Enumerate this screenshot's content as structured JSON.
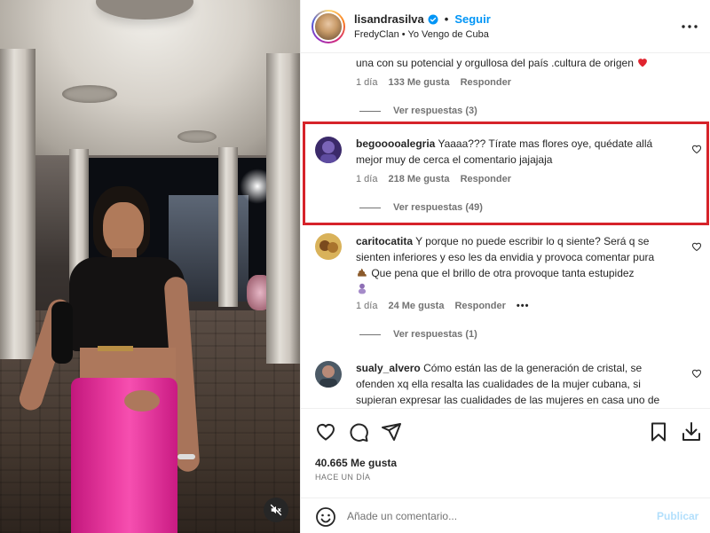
{
  "post": {
    "username": "lisandrasilva",
    "follow_label": "Seguir",
    "dot": "•",
    "subtitle": "FredyClan • Yo Vengo de Cuba",
    "more_label": "•••"
  },
  "comments": [
    {
      "text": "una con su potencial y orgullosa del país .cultura de origen",
      "emoji": "heart-emoji",
      "time": "1 día",
      "likes": "133 Me gusta",
      "reply": "Responder",
      "view_replies": "Ver respuestas (3)"
    },
    {
      "username": "begooooalegria",
      "text_line1": "Yaaaa??? Tírate mas flores oye, quédate allá",
      "text_line2": "mejor muy de cerca el comentario jajajaja",
      "time": "1 día",
      "likes": "218 Me gusta",
      "reply": "Responder",
      "view_replies": "Ver respuestas (49)",
      "highlighted": true
    },
    {
      "username": "caritocatita",
      "text_line1": "Y porque no puede escribir lo q siente? Será q se",
      "text_line2": "sienten inferiores y eso les da envidia y provoca comentar pura",
      "text_line3": "Que pena que el brillo de otra provoque tanta estupidez",
      "time": "1 día",
      "likes": "24 Me gusta",
      "reply": "Responder",
      "more": "•••",
      "view_replies": "Ver respuestas (1)"
    },
    {
      "username": "sualy_alvero",
      "text_line1": "Cómo están las de la generación de cristal, se",
      "text_line2": "ofenden xq ella resalta las cualidades de la mujer cubana, si",
      "text_line3": "supieran expresar las cualidades de las mujeres en casa uno de"
    }
  ],
  "footer": {
    "likes_total": "40.665 Me gusta",
    "ago": "HACE UN DÍA",
    "add_comment_placeholder": "Añade un comentario...",
    "publish_label": "Publicar"
  },
  "colors": {
    "accent": "#0095f6",
    "highlight_border": "#d6232a",
    "muted": "#737373",
    "skirt_pink": "#ec3ea2"
  }
}
